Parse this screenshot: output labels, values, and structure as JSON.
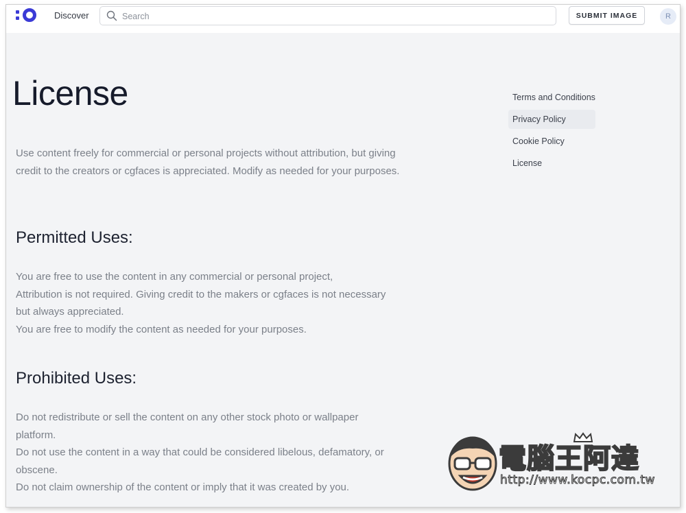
{
  "header": {
    "nav_discover": "Discover",
    "search_placeholder": "Search",
    "submit_label": "SUBMIT IMAGE",
    "avatar_initial": "R"
  },
  "colors": {
    "brand": "#3b3bd6",
    "page_bg": "#f3f4f6",
    "body_text": "#7b8089",
    "heading_text": "#161b2b"
  },
  "main": {
    "title": "License",
    "intro": "Use content freely for commercial or personal projects without attribution, but giving credit to the creators or cgfaces is appreciated. Modify as needed for your purposes.",
    "permitted": {
      "heading": "Permitted Uses:",
      "items": [
        "You are free to use the content in any commercial or personal project,",
        "Attribution is not required. Giving credit to the makers or cgfaces is not necessary but always appreciated.",
        "You are free to modify the content as needed for your purposes."
      ]
    },
    "prohibited": {
      "heading": "Prohibited Uses:",
      "items": [
        "Do not redistribute or sell the content on any other stock photo or wallpaper platform.",
        "Do not use the content in a way that could be considered libelous, defamatory, or obscene.",
        "Do not claim ownership of the content or imply that it was created by you."
      ]
    }
  },
  "sidenav": {
    "items": [
      {
        "label": "Terms and Conditions"
      },
      {
        "label": "Privacy Policy"
      },
      {
        "label": "Cookie Policy"
      },
      {
        "label": "License"
      }
    ]
  },
  "watermark": {
    "title": "電腦王阿達",
    "url": "http://www.kocpc.com.tw"
  }
}
